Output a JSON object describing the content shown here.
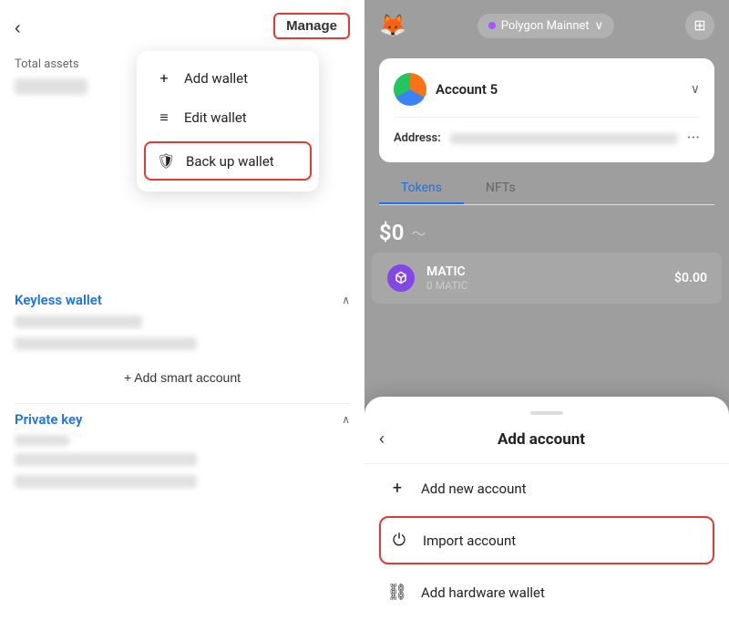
{
  "left": {
    "back_label": "‹",
    "manage_label": "Manage",
    "total_assets_label": "Total assets",
    "dropdown": {
      "items": [
        {
          "id": "add-wallet",
          "icon": "+",
          "label": "Add wallet"
        },
        {
          "id": "edit-wallet",
          "icon": "≡",
          "label": "Edit wallet"
        },
        {
          "id": "back-up-wallet",
          "icon": "🛡",
          "label": "Back up wallet",
          "highlighted": true
        }
      ]
    },
    "keyless_section": {
      "title": "Keyless wallet",
      "chevron": "∧"
    },
    "add_smart_account": "+ Add smart account",
    "private_key_section": {
      "title": "Private key",
      "chevron": "∧"
    }
  },
  "right": {
    "network": "Polygon Mainnet",
    "network_chevron": "∨",
    "account_name": "Account 5",
    "address_label": "Address:",
    "tabs": [
      {
        "id": "tokens",
        "label": "Tokens",
        "active": true
      },
      {
        "id": "nfts",
        "label": "NFTs",
        "active": false
      }
    ],
    "balance": "$0",
    "token": {
      "name": "MATIC",
      "balance": "0 MATIC",
      "value": "$0.00"
    },
    "add_account_sheet": {
      "title": "Add account",
      "back": "‹",
      "items": [
        {
          "id": "add-new-account",
          "icon": "+",
          "label": "Add new account",
          "highlighted": false
        },
        {
          "id": "import-account",
          "icon": "⏻",
          "label": "Import account",
          "highlighted": true
        },
        {
          "id": "add-hardware-wallet",
          "icon": "⛓",
          "label": "Add hardware wallet",
          "highlighted": false
        }
      ]
    }
  }
}
